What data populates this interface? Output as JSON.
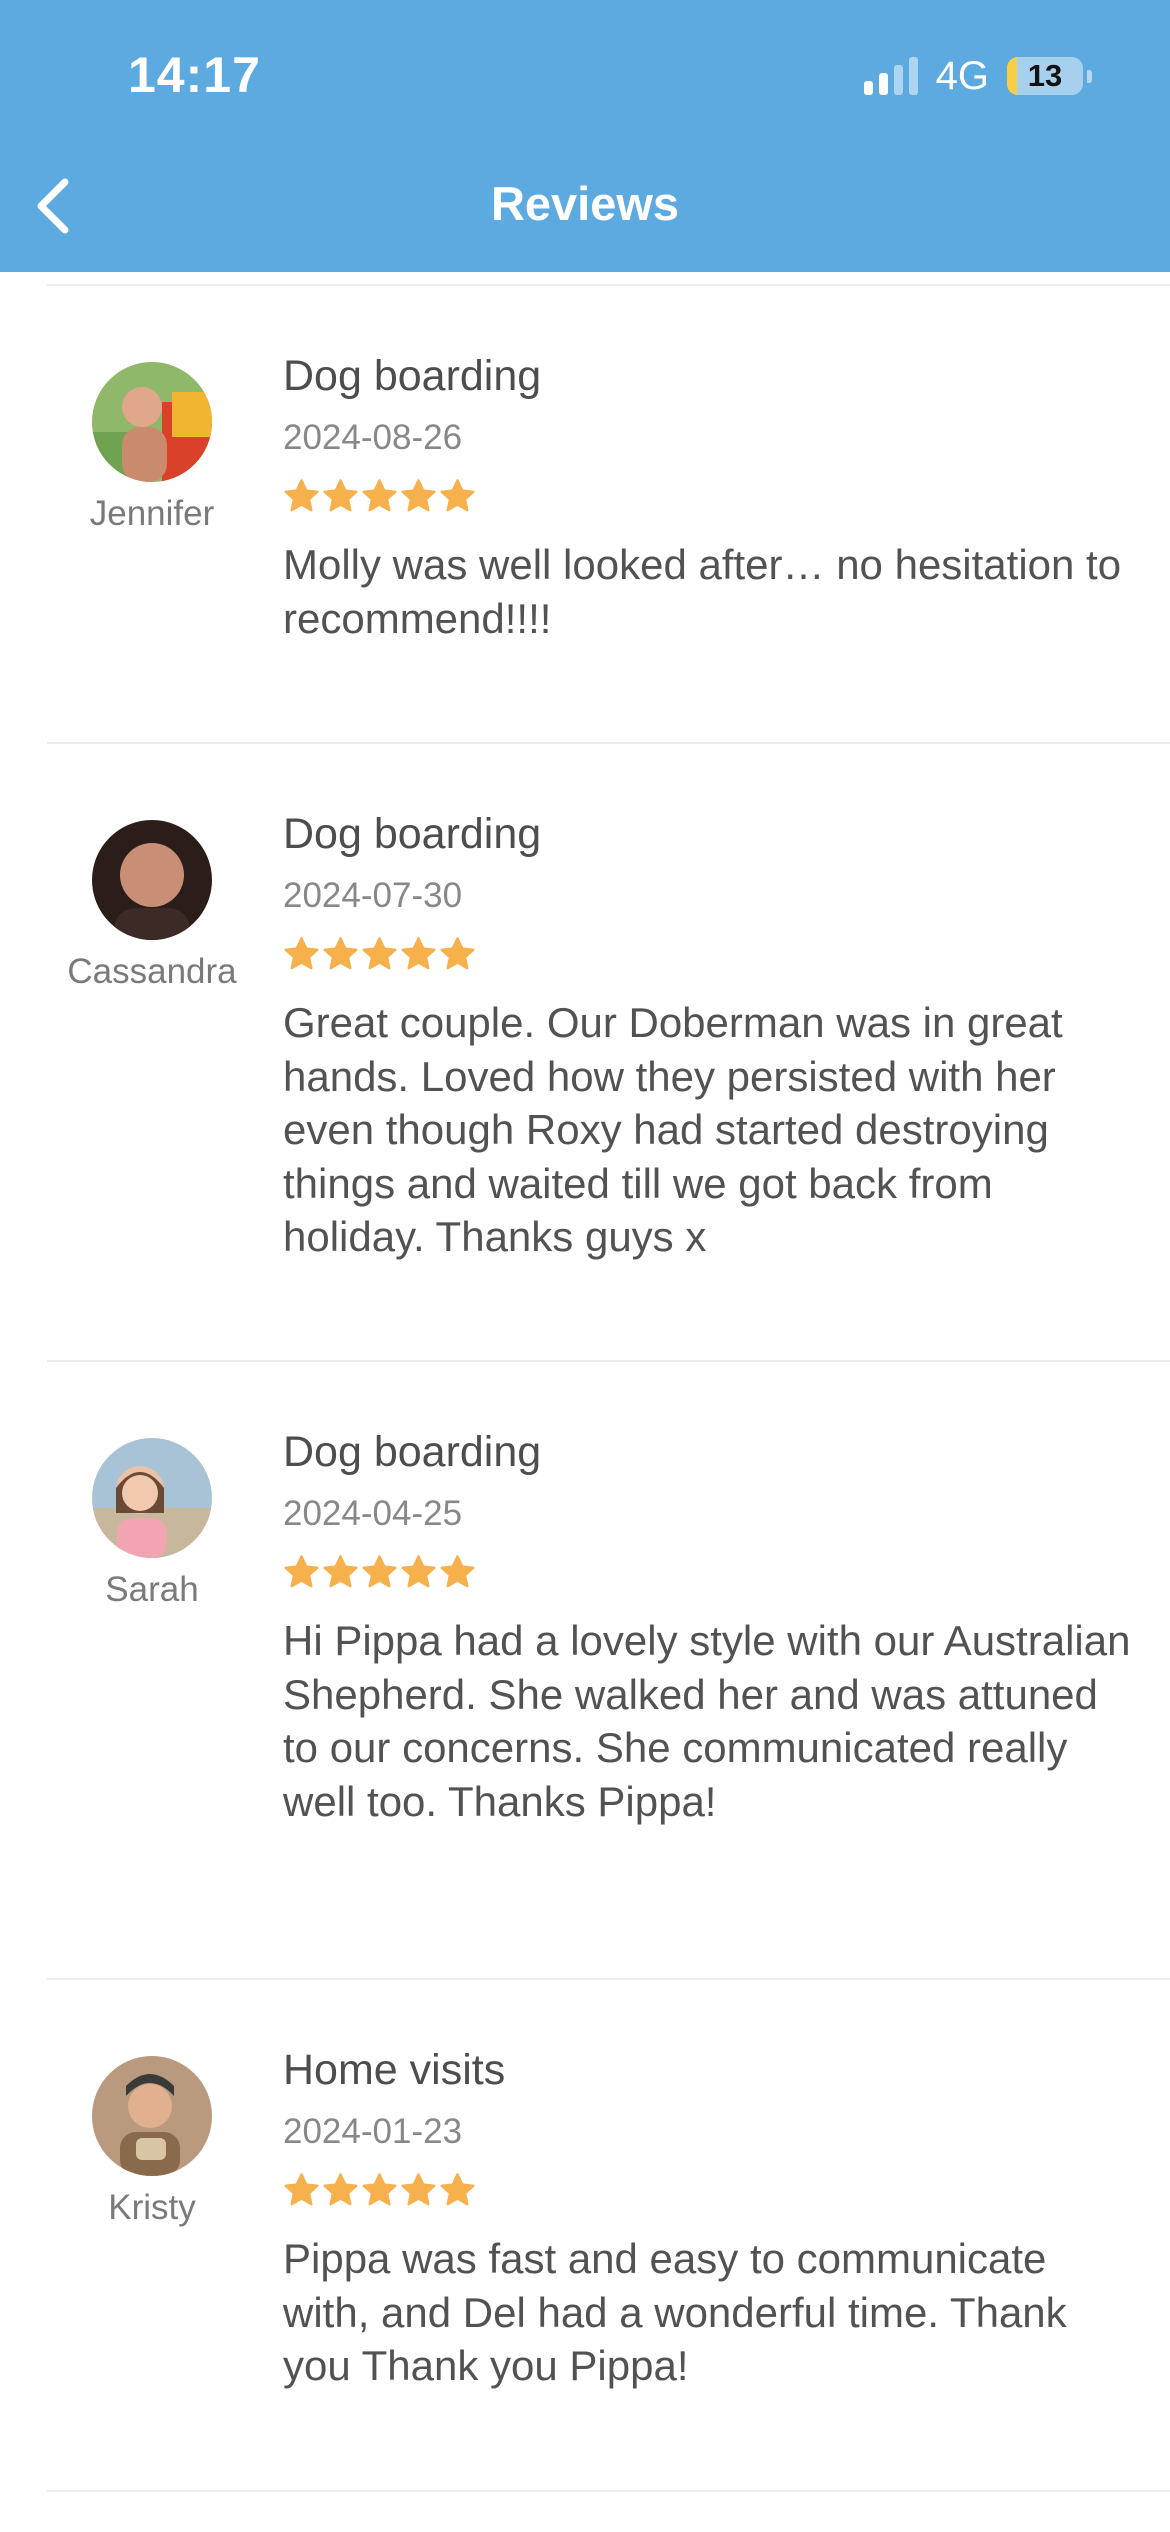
{
  "status_bar": {
    "time": "14:17",
    "network": "4G",
    "battery_level": "13",
    "battery_fraction": 0.13,
    "signal_bars_active": 2,
    "signal_bars_total": 4
  },
  "nav": {
    "title": "Reviews",
    "back_icon": "chevron-left-icon"
  },
  "colors": {
    "header_bg": "#5DAAE0",
    "star": "#F6B04C",
    "battery_fill": "#F7CE46"
  },
  "reviews": [
    {
      "name": "Jennifer",
      "service": "Dog boarding",
      "date": "2024-08-26",
      "rating": 5,
      "text": "Molly was well looked after… no hesitation to recommend!!!!"
    },
    {
      "name": "Cassandra",
      "service": "Dog boarding",
      "date": "2024-07-30",
      "rating": 5,
      "text": "Great couple. Our Doberman was in great hands. Loved how they persisted with her even though Roxy had started destroying things and waited till we got back from holiday. Thanks guys x"
    },
    {
      "name": "Sarah",
      "service": "Dog boarding",
      "date": "2024-04-25",
      "rating": 5,
      "text": "Hi Pippa had a lovely style with our Australian Shepherd. She walked her and was attuned to our concerns. She communicated really well too. Thanks Pippa!"
    },
    {
      "name": "Kristy",
      "service": "Home visits",
      "date": "2024-01-23",
      "rating": 5,
      "text": "Pippa was fast and easy to communicate with, and Del had a wonderful time. Thank you Thank you Pippa!"
    }
  ]
}
